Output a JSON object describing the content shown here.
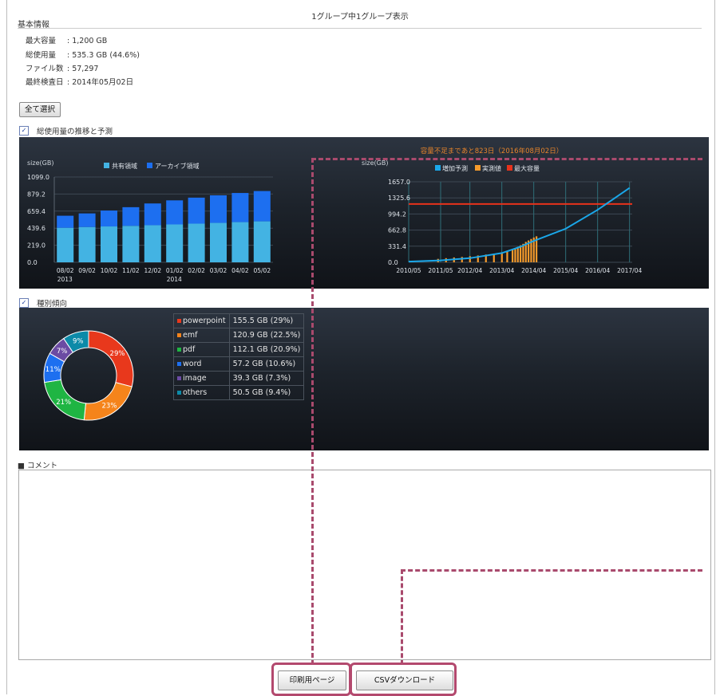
{
  "header": {
    "group_display": "1グループ中1グループ表示"
  },
  "basic_info": {
    "title": "基本情報",
    "rows": [
      {
        "label": "最大容量",
        "value": ": 1,200 GB"
      },
      {
        "label": "総使用量",
        "value": ": 535.3 GB (44.6%)"
      },
      {
        "label": "ファイル数",
        "value": ": 57,297"
      },
      {
        "label": "最終検査日",
        "value": ": 2014年05月02日"
      }
    ]
  },
  "select_all_label": "全て選択",
  "usage_section": {
    "checkbox_label": "総使用量の推移と予測",
    "checked": true
  },
  "type_section": {
    "checkbox_label": "種別傾向",
    "checked": true
  },
  "check_glyph": "✓",
  "colors": {
    "shared": "#43b3e3",
    "archive": "#1d6ff0",
    "forecast": "#1aa7e9",
    "measured": "#f59a2c",
    "max": "#e8321b",
    "powerpoint": "#e8381c",
    "emf": "#f5841b",
    "pdf": "#1fb543",
    "word": "#1d6ff0",
    "image": "#6b4ba3",
    "others": "#0c8aa8",
    "warning_text": "#e6842b"
  },
  "chart_data": [
    {
      "type": "bar",
      "title": "",
      "ylabel": "size(GB)",
      "ylim": [
        0,
        1099.0
      ],
      "yticks": [
        "1099.0",
        "879.2",
        "659.4",
        "439.6",
        "219.0",
        "0.0"
      ],
      "categories": [
        "08/02",
        "09/02",
        "10/02",
        "11/02",
        "12/02",
        "01/02",
        "02/02",
        "03/02",
        "04/02",
        "05/02"
      ],
      "year_labels": [
        {
          "text": "2013",
          "at": 0
        },
        {
          "text": "2014",
          "at": 5
        }
      ],
      "stacked": true,
      "series": [
        {
          "name": "共有領域",
          "values": [
            445,
            455,
            462,
            470,
            478,
            488,
            498,
            508,
            518,
            528
          ]
        },
        {
          "name": "アーカイブ領域",
          "values": [
            155,
            175,
            205,
            240,
            280,
            310,
            335,
            355,
            375,
            390
          ]
        }
      ]
    },
    {
      "type": "line",
      "title": "容量不足まであと823日（2016年08月02日）",
      "ylabel": "size(GB)",
      "ylim": [
        0,
        1657.0
      ],
      "yticks": [
        "1657.0",
        "1325.6",
        "994.2",
        "662.8",
        "331.4",
        "0.0"
      ],
      "x_labels": [
        "2010/05",
        "2011/05",
        "2012/04",
        "2013/04",
        "2014/04",
        "2015/04",
        "2016/04",
        "2017/04"
      ],
      "x_range": [
        "2010/05",
        "2017/05"
      ],
      "series": [
        {
          "name": "増加予測",
          "points": [
            [
              "2010/05",
              15
            ],
            [
              "2011/05",
              40
            ],
            [
              "2012/04",
              85
            ],
            [
              "2013/04",
              190
            ],
            [
              "2013/11",
              320
            ],
            [
              "2014/04",
              440
            ],
            [
              "2015/04",
              690
            ],
            [
              "2016/04",
              1080
            ],
            [
              "2017/04",
              1530
            ]
          ]
        },
        {
          "name": "実測値",
          "bars": [
            [
              "2011/04",
              70
            ],
            [
              "2011/07",
              85
            ],
            [
              "2011/10",
              100
            ],
            [
              "2012/01",
              110
            ],
            [
              "2012/04",
              125
            ],
            [
              "2012/07",
              140
            ],
            [
              "2012/10",
              160
            ],
            [
              "2013/01",
              180
            ],
            [
              "2013/04",
              200
            ],
            [
              "2013/06",
              230
            ],
            [
              "2013/08",
              260
            ],
            [
              "2013/09",
              290
            ],
            [
              "2013/10",
              320
            ],
            [
              "2013/11",
              350
            ],
            [
              "2013/12",
              380
            ],
            [
              "2014/01",
              420
            ],
            [
              "2014/02",
              450
            ],
            [
              "2014/03",
              480
            ],
            [
              "2014/04",
              510
            ],
            [
              "2014/05",
              535
            ]
          ]
        },
        {
          "name": "最大容量",
          "constant": 1200
        }
      ]
    },
    {
      "type": "pie",
      "donut": true,
      "slices": [
        {
          "label": "powerpoint",
          "value": 155.5,
          "text": "155.5 GB (29%)",
          "pct_label": "29%"
        },
        {
          "label": "emf",
          "value": 120.9,
          "text": "120.9 GB (22.5%)",
          "pct_label": "23%"
        },
        {
          "label": "pdf",
          "value": 112.1,
          "text": "112.1 GB (20.9%)",
          "pct_label": "21%"
        },
        {
          "label": "word",
          "value": 57.2,
          "text": "57.2 GB (10.6%)",
          "pct_label": "11%"
        },
        {
          "label": "image",
          "value": 39.3,
          "text": "39.3 GB (7.3%)",
          "pct_label": "7%"
        },
        {
          "label": "others",
          "value": 50.5,
          "text": "50.5 GB (9.4%)",
          "pct_label": "9%"
        }
      ]
    }
  ],
  "comment": {
    "label": "■ コメント",
    "value": ""
  },
  "buttons": {
    "print": "印刷用ページ",
    "csv": "CSVダウンロード"
  },
  "scroll_icons": {
    "up": "▲",
    "down": "▼"
  }
}
